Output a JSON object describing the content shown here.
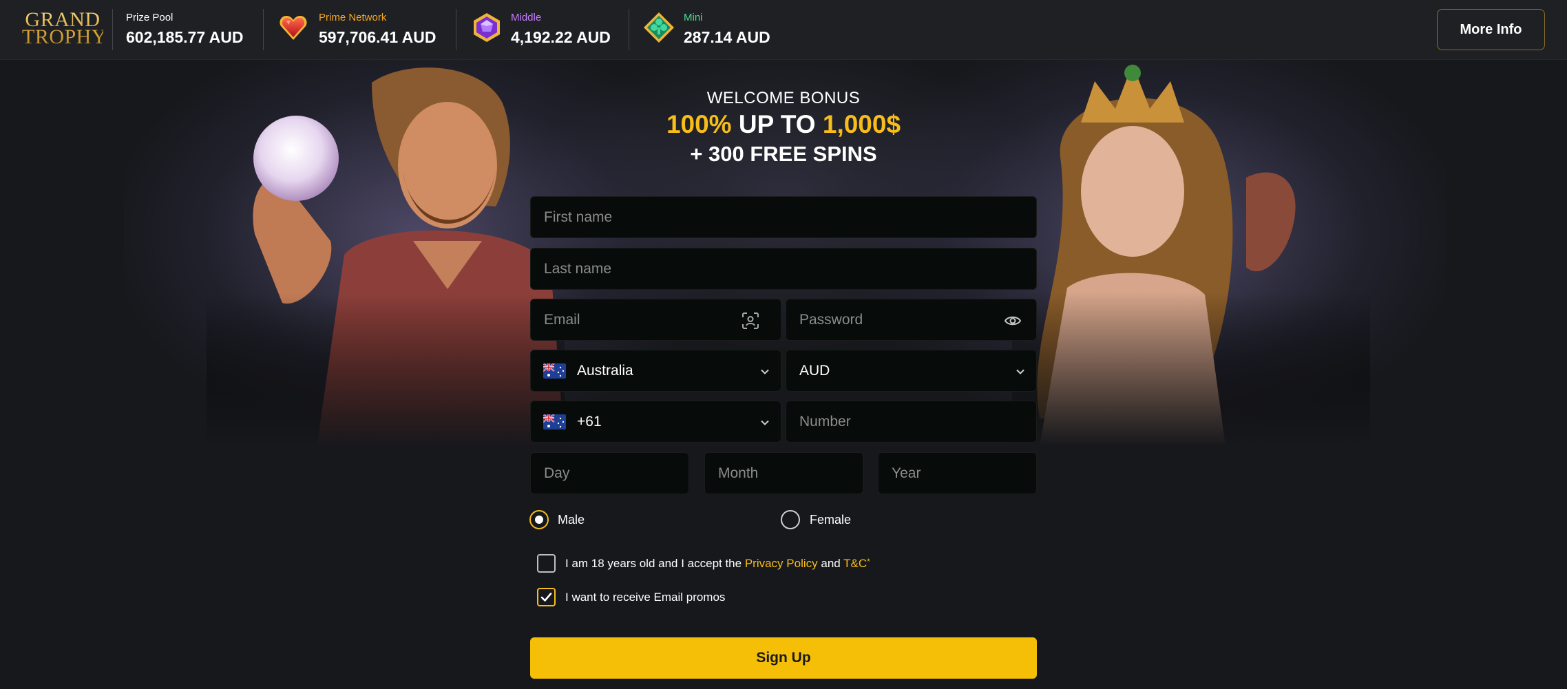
{
  "header": {
    "logo_line1": "GRAND",
    "logo_line2": "TROPHY",
    "jackpots": [
      {
        "label": "Prize Pool",
        "amount": "602,185.77 AUD",
        "label_color": "#ffffff",
        "icon": "none"
      },
      {
        "label": "Prime Network",
        "amount": "597,706.41 AUD",
        "label_color": "#f5a623",
        "icon": "red-heart-gem-icon"
      },
      {
        "label": "Middle",
        "amount": "4,192.22 AUD",
        "label_color": "#c77dff",
        "icon": "purple-gem-icon"
      },
      {
        "label": "Mini",
        "amount": "287.14 AUD",
        "label_color": "#4cd98f",
        "icon": "green-gem-icon"
      }
    ],
    "more_info_label": "More Info"
  },
  "hero": {
    "welcome": "WELCOME BONUS",
    "headline_part1": "100%",
    "headline_part2": " UP TO ",
    "headline_part3": "1,000$",
    "subline": "+ 300 FREE SPINS"
  },
  "form": {
    "first_name_placeholder": "First name",
    "last_name_placeholder": "Last name",
    "email_placeholder": "Email",
    "password_placeholder": "Password",
    "country_value": "Australia",
    "currency_value": "AUD",
    "phone_code_value": "+61",
    "number_placeholder": "Number",
    "day_placeholder": "Day",
    "month_placeholder": "Month",
    "year_placeholder": "Year",
    "gender_male": "Male",
    "gender_female": "Female",
    "gender_selected": "Male",
    "terms_text_before": "I am 18 years old and I accept the ",
    "terms_privacy_link": "Privacy Policy",
    "terms_and": " and ",
    "terms_tc_link": "T&C",
    "terms_asterisk": "*",
    "terms_checked": false,
    "promos_text": "I want to receive Email promos",
    "promos_checked": true,
    "signup_label": "Sign Up"
  },
  "colors": {
    "accent": "#f5bf07",
    "gold_text": "#f7bd1b",
    "background": "#17181c",
    "input_bg": "#070b09"
  }
}
